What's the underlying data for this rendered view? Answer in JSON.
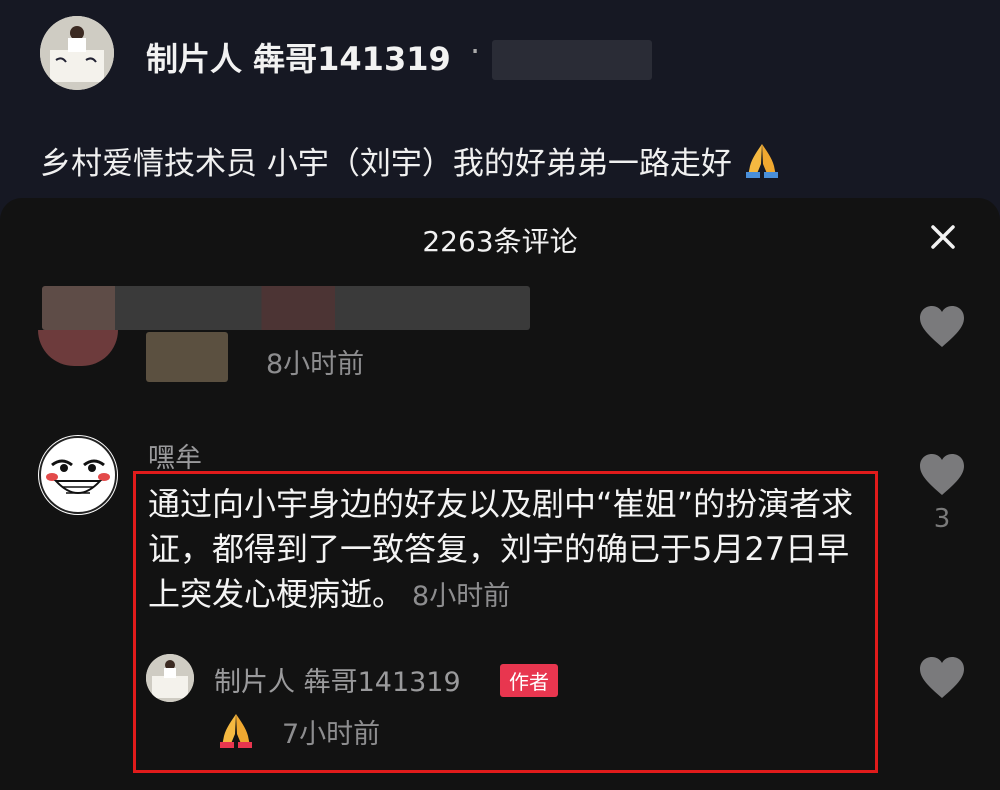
{
  "post": {
    "author": "制片人 犇哥141319",
    "separator": "·",
    "caption": "乡村爱情技术员 小宇（刘宇）我的好弟弟一路走好"
  },
  "comments_panel": {
    "title": "2263条评论",
    "close_icon": "close-icon",
    "items": [
      {
        "time": "8小时前",
        "like_icon": "heart-icon"
      },
      {
        "username": "嘿牟",
        "text": "通过向小宇身边的好友以及剧中“崔姐”的扮演者求证，都得到了一致答复，刘宇的确已于5月27日早上突发心梗病逝。",
        "time": "8小时前",
        "like_count": "3",
        "reply": {
          "username": "制片人 犇哥141319",
          "badge": "作者",
          "emoji": "praying-hands-icon",
          "time": "7小时前"
        }
      }
    ]
  },
  "colors": {
    "background": "#161823",
    "highlight_box": "#e01b1b",
    "author_badge": "#e8364f"
  }
}
